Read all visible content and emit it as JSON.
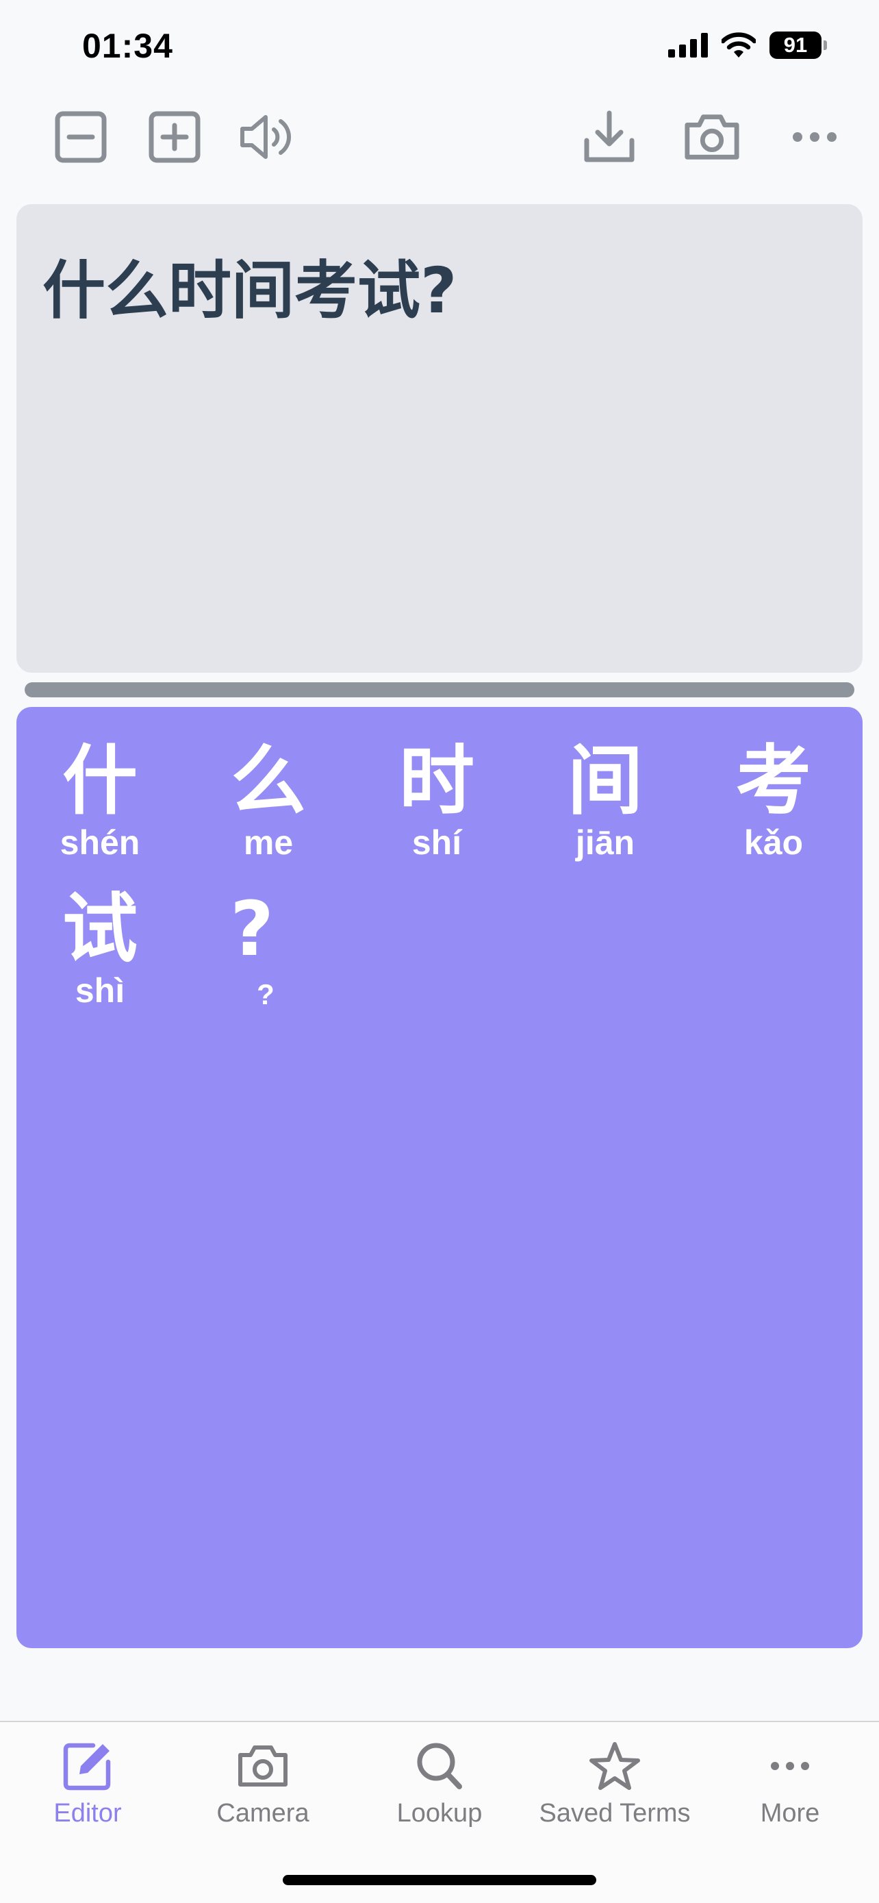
{
  "status_bar": {
    "time": "01:34",
    "battery": "91"
  },
  "toolbar": {
    "left": [
      "zoom-out",
      "zoom-in",
      "speaker"
    ],
    "right": [
      "download",
      "camera",
      "more"
    ]
  },
  "editor": {
    "text": "什么时间考试?"
  },
  "pinyin": [
    {
      "hanzi": "什",
      "pinyin": "shén"
    },
    {
      "hanzi": "么",
      "pinyin": "me"
    },
    {
      "hanzi": "时",
      "pinyin": "shí"
    },
    {
      "hanzi": "间",
      "pinyin": "jiān"
    },
    {
      "hanzi": "考",
      "pinyin": "kǎo"
    },
    {
      "hanzi": "试",
      "pinyin": "shì"
    },
    {
      "hanzi": "?",
      "pinyin": "?"
    }
  ],
  "tabs": [
    {
      "label": "Editor",
      "icon": "edit-icon",
      "active": true
    },
    {
      "label": "Camera",
      "icon": "camera-icon",
      "active": false
    },
    {
      "label": "Lookup",
      "icon": "search-icon",
      "active": false
    },
    {
      "label": "Saved Terms",
      "icon": "star-icon",
      "active": false
    },
    {
      "label": "More",
      "icon": "ellipsis-icon",
      "active": false
    }
  ],
  "colors": {
    "accent": "#958cf5",
    "active_tab": "#8b80ee",
    "input_bg": "#e4e5ea",
    "input_text": "#2c3e50",
    "icon_gray": "#8a8e95"
  }
}
